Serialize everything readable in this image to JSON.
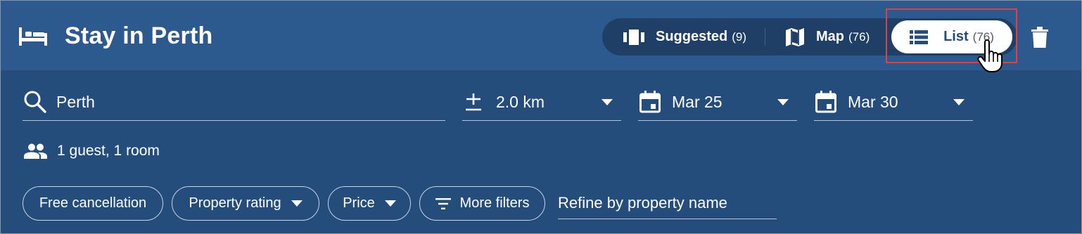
{
  "header": {
    "title": "Stay in Perth",
    "icon": "hotel-bed-icon"
  },
  "view_toggle": {
    "suggested": {
      "label": "Suggested",
      "count": "(9)",
      "icon": "carousel-icon"
    },
    "map": {
      "label": "Map",
      "count": "(76)",
      "icon": "map-icon"
    },
    "list": {
      "label": "List",
      "count": "(76)",
      "icon": "list-icon",
      "selected": true
    }
  },
  "delete_icon": "trash-icon",
  "search": {
    "location": "Perth",
    "radius": "2.0 km",
    "check_in": "Mar 25",
    "check_out": "Mar 30",
    "guests": "1 guest, 1 room"
  },
  "filters": {
    "free_cancellation": "Free cancellation",
    "property_rating": "Property rating",
    "price": "Price",
    "more_filters": "More filters",
    "refine_placeholder": "Refine by property name"
  },
  "colors": {
    "background": "#254d7c",
    "header": "#2c5a8f",
    "toggle_bg": "#1f3f66",
    "highlight": "#e0403f"
  }
}
